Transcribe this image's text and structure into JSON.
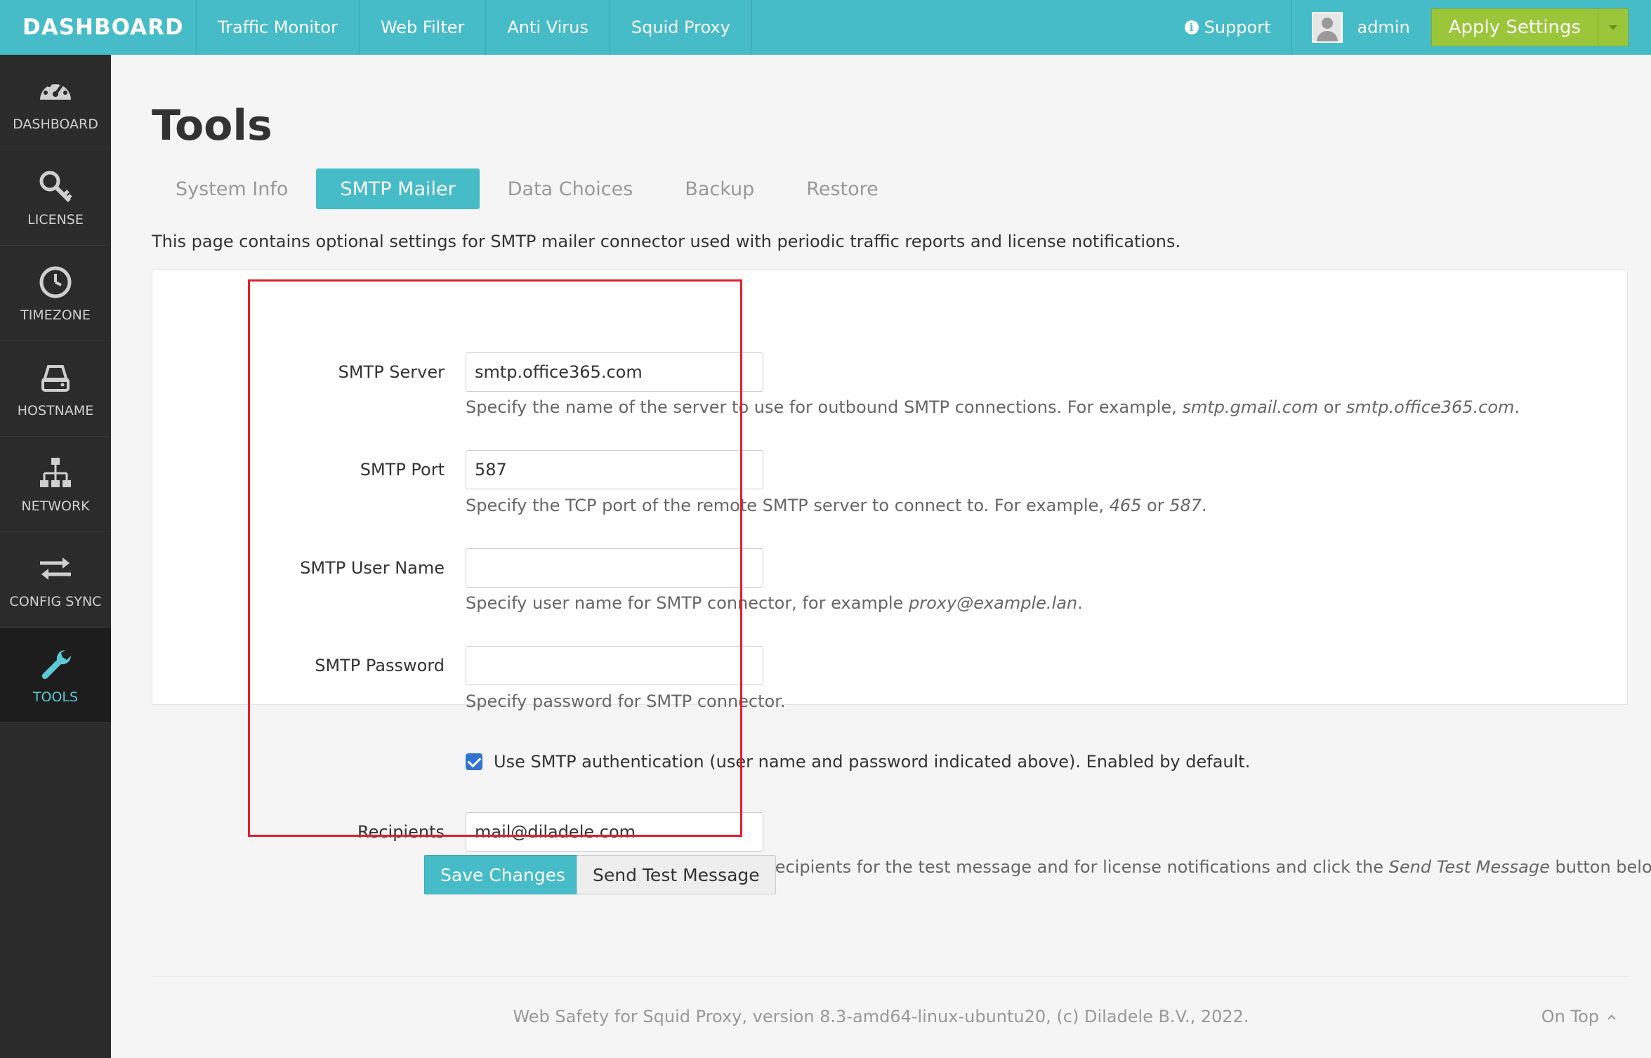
{
  "header": {
    "brand": "DASHBOARD",
    "nav": [
      "Traffic Monitor",
      "Web Filter",
      "Anti Virus",
      "Squid Proxy"
    ],
    "support_label": "Support",
    "user_name": "admin",
    "apply_label": "Apply Settings"
  },
  "sidebar": {
    "items": [
      {
        "label": "DASHBOARD",
        "icon": "gauge-icon"
      },
      {
        "label": "LICENSE",
        "icon": "key-icon"
      },
      {
        "label": "TIMEZONE",
        "icon": "clock-icon"
      },
      {
        "label": "HOSTNAME",
        "icon": "drive-icon"
      },
      {
        "label": "NETWORK",
        "icon": "sitemap-icon"
      },
      {
        "label": "CONFIG SYNC",
        "icon": "exchange-icon"
      },
      {
        "label": "TOOLS",
        "icon": "wrench-icon"
      }
    ],
    "active": "TOOLS"
  },
  "main": {
    "title": "Tools",
    "tabs": [
      "System Info",
      "SMTP Mailer",
      "Data Choices",
      "Backup",
      "Restore"
    ],
    "active_tab": "SMTP Mailer",
    "description": "This page contains optional settings for SMTP mailer connector used with periodic traffic reports and license notifications."
  },
  "form": {
    "server": {
      "label": "SMTP Server",
      "value": "smtp.office365.com",
      "help_prefix": "Specify the name of the server to use for outbound SMTP connections. For example, ",
      "help_ex1": "smtp.gmail.com",
      "help_mid": " or ",
      "help_ex2": "smtp.office365.com",
      "help_suffix": "."
    },
    "port": {
      "label": "SMTP Port",
      "value": "587",
      "help_prefix": "Specify the TCP port of the remote SMTP server to connect to. For example, ",
      "help_ex1": "465",
      "help_mid": " or ",
      "help_ex2": "587",
      "help_suffix": "."
    },
    "username": {
      "label": "SMTP User Name",
      "value": "",
      "help_prefix": "Specify user name for SMTP connector, for example ",
      "help_ex1": "proxy@example.lan",
      "help_suffix": "."
    },
    "password": {
      "label": "SMTP Password",
      "value": "",
      "help": "Specify password for SMTP connector."
    },
    "auth": {
      "checked": true,
      "label": "Use SMTP authentication (user name and password indicated above). Enabled by default."
    },
    "recipients": {
      "label": "Recipients",
      "value": "mail@diladele.com",
      "help_prefix": "Specify the e-mail addresses of the recipients for the test message and for license notifications and click the ",
      "help_ex1": "Send Test Message",
      "help_suffix": " button below."
    },
    "save_label": "Save Changes",
    "test_label": "Send Test Message"
  },
  "footer": {
    "text": "Web Safety for Squid Proxy, version 8.3-amd64-linux-ubuntu20, (c) Diladele B.V., 2022.",
    "on_top": "On Top"
  },
  "colors": {
    "accent": "#45bcc8",
    "apply": "#9bc63a",
    "sidebar": "#2b2b2b",
    "highlight": "#e0202a"
  }
}
